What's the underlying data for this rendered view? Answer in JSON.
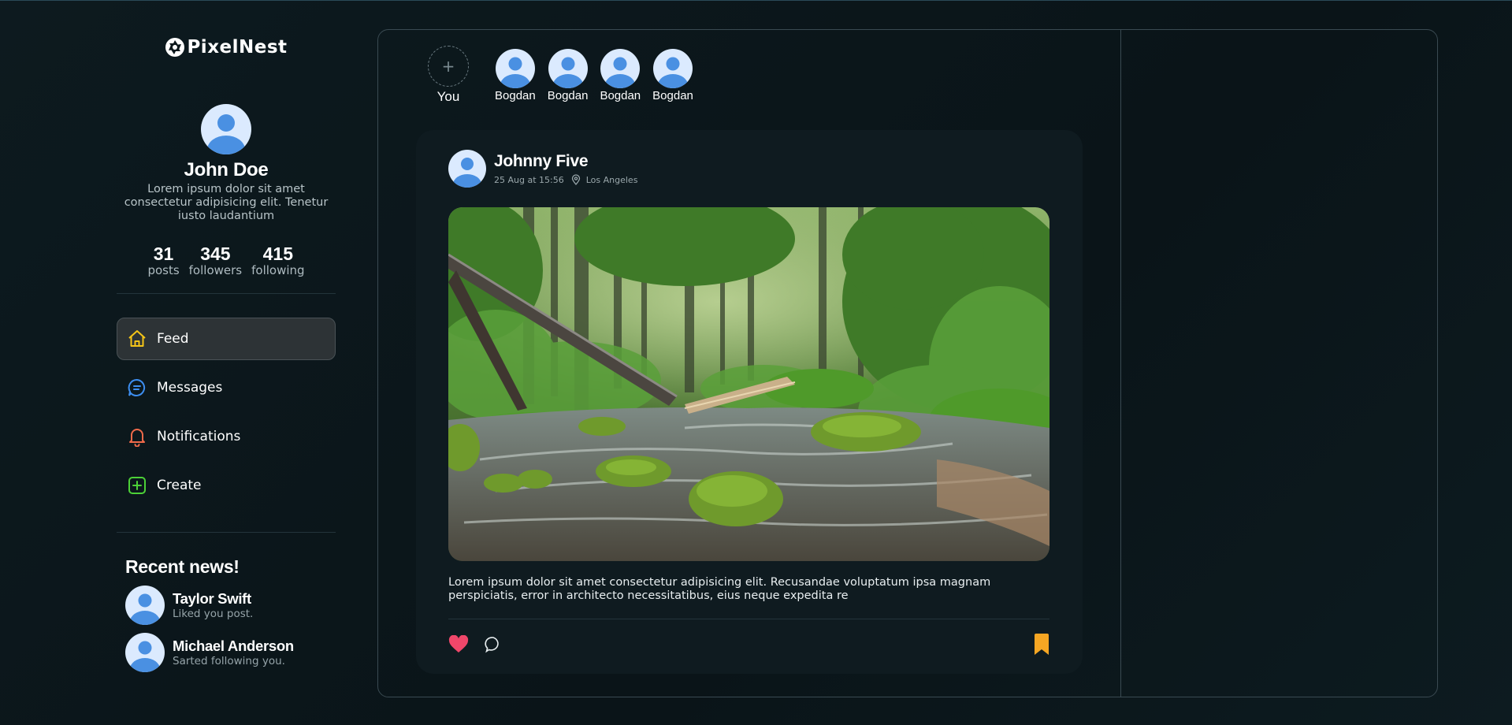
{
  "app": {
    "name": "PixelNest"
  },
  "profile": {
    "name": "John Doe",
    "bio": "Lorem ipsum dolor sit amet consectetur adipisicing elit. Tenetur iusto laudantium",
    "stats": [
      {
        "value": "31",
        "label": "posts"
      },
      {
        "value": "345",
        "label": "followers"
      },
      {
        "value": "415",
        "label": "following"
      }
    ]
  },
  "nav": [
    {
      "label": "Feed",
      "icon": "home-icon",
      "color": "#f5c518",
      "active": true
    },
    {
      "label": "Messages",
      "icon": "message-icon",
      "color": "#3d8ef0",
      "active": false
    },
    {
      "label": "Notifications",
      "icon": "bell-icon",
      "color": "#f06a4a",
      "active": false
    },
    {
      "label": "Create",
      "icon": "plus-square-icon",
      "color": "#4cd137",
      "active": false
    }
  ],
  "recent_news": {
    "title": "Recent news!",
    "items": [
      {
        "name": "Taylor Swift",
        "desc": "Liked you post."
      },
      {
        "name": "Michael Anderson",
        "desc": "Sarted following you."
      }
    ]
  },
  "stories": {
    "you_label": "You",
    "items": [
      {
        "name": "Bogdan"
      },
      {
        "name": "Bogdan"
      },
      {
        "name": "Bogdan"
      },
      {
        "name": "Bogdan"
      }
    ]
  },
  "post": {
    "author": "Johnny Five",
    "date": "25 Aug at 15:56",
    "location": "Los Angeles",
    "text": "Lorem ipsum dolor sit amet consectetur adipisicing elit. Recusandae voluptatum ipsa magnam perspiciatis, error in architecto necessitatibus, eius neque expedita re",
    "image": "forest-river-photo"
  },
  "colors": {
    "accent_like": "#f0476a",
    "accent_bookmark": "#f5a623",
    "avatar_bg": "#dbeafe",
    "avatar_fg": "#4a90e2"
  }
}
